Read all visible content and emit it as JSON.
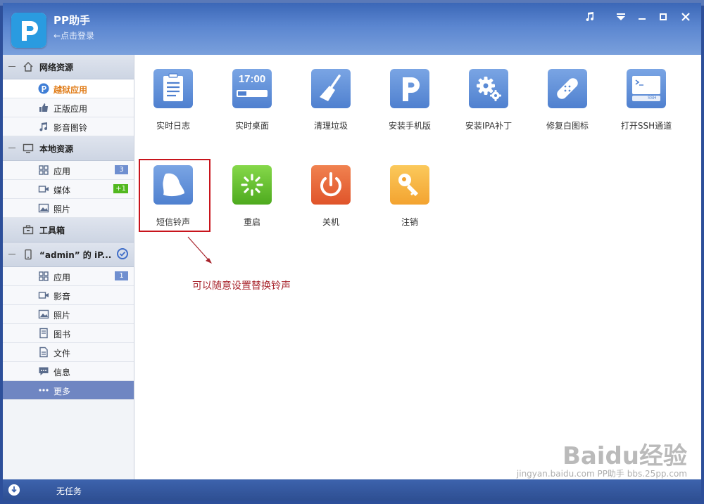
{
  "app": {
    "title": "PP助手",
    "login": "←点击登录"
  },
  "sidebar": {
    "network": {
      "label": "网络资源",
      "items": [
        {
          "label": "越狱应用",
          "icon": "pp-icon",
          "active": true
        },
        {
          "label": "正版应用",
          "icon": "thumbs-up-icon"
        },
        {
          "label": "影音图铃",
          "icon": "music-note-icon"
        }
      ]
    },
    "local": {
      "label": "本地资源",
      "items": [
        {
          "label": "应用",
          "icon": "grid-icon",
          "badge": "3"
        },
        {
          "label": "媒体",
          "icon": "video-icon",
          "badge": "+1"
        },
        {
          "label": "照片",
          "icon": "photo-icon"
        }
      ]
    },
    "toolbox": {
      "label": "工具箱"
    },
    "device": {
      "label": "“admin” 的 iP...",
      "items": [
        {
          "label": "应用",
          "icon": "grid-icon",
          "badge": "1"
        },
        {
          "label": "影音",
          "icon": "video-icon"
        },
        {
          "label": "照片",
          "icon": "photo-icon"
        },
        {
          "label": "图书",
          "icon": "book-icon"
        },
        {
          "label": "文件",
          "icon": "file-icon"
        },
        {
          "label": "信息",
          "icon": "message-icon"
        },
        {
          "label": "更多",
          "icon": "more-dots-icon",
          "selected": true
        }
      ]
    }
  },
  "tools": [
    {
      "label": "实时日志",
      "icon": "log-icon"
    },
    {
      "label": "实时桌面",
      "icon": "clock-icon",
      "clock_text": "17:00"
    },
    {
      "label": "清理垃圾",
      "icon": "broom-icon"
    },
    {
      "label": "安装手机版",
      "icon": "pp-icon"
    },
    {
      "label": "安装IPA补丁",
      "icon": "gear-icon"
    },
    {
      "label": "修复白图标",
      "icon": "bandage-icon"
    },
    {
      "label": "打开SSH通道",
      "icon": "terminal-icon",
      "ssh_text": "SSH"
    },
    {
      "label": "短信铃声",
      "icon": "bell-icon"
    },
    {
      "label": "重启",
      "icon": "restart-icon"
    },
    {
      "label": "关机",
      "icon": "power-icon"
    },
    {
      "label": "注销",
      "icon": "key-icon"
    }
  ],
  "annotation": "可以随意设置替换铃声",
  "status": {
    "label": "无任务"
  },
  "watermark": {
    "main": "Baidu经验",
    "sub": "jingyan.baidu.com  PP助手  bbs.25pp.com"
  },
  "colors": {
    "accent": "#e07b16",
    "highlight": "#c8141c",
    "title_bar": "#4a74c2"
  }
}
